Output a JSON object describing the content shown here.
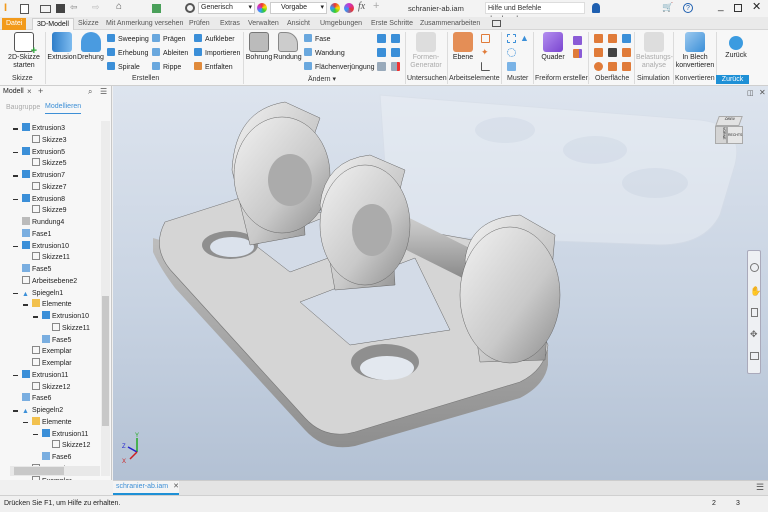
{
  "titlebar": {
    "appearance_style": "Generisch",
    "material": "Vorgabe",
    "document_title": "schranier-ab.iam",
    "search_placeholder": "Hilfe und Befehle durchsuchen...",
    "help_label": "?"
  },
  "tabs": [
    "Datei",
    "3D-Modell",
    "Skizze",
    "Mit Anmerkung versehen",
    "Prüfen",
    "Extras",
    "Verwalten",
    "Ansicht",
    "Umgebungen",
    "Erste Schritte",
    "Zusammenarbeiten"
  ],
  "active_tab": "3D-Modell",
  "ribbon": {
    "skizze": {
      "button": "2D-Skizze starten",
      "label": "Skizze"
    },
    "erstellen": {
      "label": "Erstellen",
      "extrusion": "Extrusion",
      "drehung": "Drehung",
      "col1": [
        "Sweeping",
        "Erhebung",
        "Spirale"
      ],
      "col2": [
        "Prägen",
        "Ableiten",
        "Rippe"
      ],
      "col3": [
        "Aufkleber",
        "Importieren",
        "Entfalten"
      ]
    },
    "aendern": {
      "label": "Ändern ▾",
      "bohrung": "Bohrung",
      "rundung": "Rundung",
      "col": [
        "Fase",
        "Wandung",
        "Flächenverjüngung"
      ]
    },
    "untersuchen": {
      "label": "Untersuchen",
      "button": "Formen-Generator"
    },
    "arbeitselemente": {
      "label": "Arbeitselemente",
      "button": "Ebene"
    },
    "muster": {
      "label": "Muster"
    },
    "freiform": {
      "label": "Freiform erstellen",
      "button": "Quader"
    },
    "oberflaeche": {
      "label": "Oberfläche"
    },
    "simulation": {
      "label": "Simulation",
      "button": "Belastungs-analyse"
    },
    "konvertieren": {
      "label": "Konvertieren",
      "button": "In Blech konvertieren"
    },
    "zurueck": {
      "label": "Zurück",
      "button": "Zurück"
    }
  },
  "browser": {
    "title": "Modell",
    "subtab_assembly": "Baugruppe",
    "subtab_modeling": "Modellieren",
    "tree": [
      {
        "label": "Extrusion3",
        "level": 0,
        "icon": "extrusion",
        "expanded": true
      },
      {
        "label": "Skizze3",
        "level": 1,
        "icon": "sketch"
      },
      {
        "label": "Extrusion5",
        "level": 0,
        "icon": "extrusion",
        "expanded": true
      },
      {
        "label": "Skizze5",
        "level": 1,
        "icon": "sketch"
      },
      {
        "label": "Extrusion7",
        "level": 0,
        "icon": "extrusion",
        "expanded": true
      },
      {
        "label": "Skizze7",
        "level": 1,
        "icon": "sketch"
      },
      {
        "label": "Extrusion8",
        "level": 0,
        "icon": "extrusion",
        "expanded": true
      },
      {
        "label": "Skizze9",
        "level": 1,
        "icon": "sketch"
      },
      {
        "label": "Rundung4",
        "level": 0,
        "icon": "fillet"
      },
      {
        "label": "Fase1",
        "level": 0,
        "icon": "chamfer"
      },
      {
        "label": "Extrusion10",
        "level": 0,
        "icon": "extrusion",
        "expanded": true
      },
      {
        "label": "Skizze11",
        "level": 1,
        "icon": "sketch"
      },
      {
        "label": "Fase5",
        "level": 0,
        "icon": "chamfer"
      },
      {
        "label": "Arbeitsebene2",
        "level": 0,
        "icon": "workplane"
      },
      {
        "label": "Spiegeln1",
        "level": 0,
        "icon": "mirror",
        "expanded": true
      },
      {
        "label": "Elemente",
        "level": 1,
        "icon": "folder",
        "expanded": true
      },
      {
        "label": "Extrusion10",
        "level": 2,
        "icon": "extrusion",
        "expanded": true
      },
      {
        "label": "Skizze11",
        "level": 3,
        "icon": "sketch"
      },
      {
        "label": "Fase5",
        "level": 2,
        "icon": "chamfer"
      },
      {
        "label": "Exemplar",
        "level": 1,
        "icon": "instance"
      },
      {
        "label": "Exemplar",
        "level": 1,
        "icon": "instance"
      },
      {
        "label": "Extrusion11",
        "level": 0,
        "icon": "extrusion",
        "expanded": true
      },
      {
        "label": "Skizze12",
        "level": 1,
        "icon": "sketch"
      },
      {
        "label": "Fase6",
        "level": 0,
        "icon": "chamfer"
      },
      {
        "label": "Spiegeln2",
        "level": 0,
        "icon": "mirror",
        "expanded": true
      },
      {
        "label": "Elemente",
        "level": 1,
        "icon": "folder",
        "expanded": true
      },
      {
        "label": "Extrusion11",
        "level": 2,
        "icon": "extrusion",
        "expanded": true
      },
      {
        "label": "Skizze12",
        "level": 3,
        "icon": "sketch"
      },
      {
        "label": "Fase6",
        "level": 2,
        "icon": "chamfer"
      },
      {
        "label": "Exemplar",
        "level": 1,
        "icon": "instance"
      },
      {
        "label": "Exemplar",
        "level": 1,
        "icon": "instance"
      }
    ]
  },
  "viewcube": {
    "face_front": "VORNE",
    "face_right": "RECHTS",
    "face_top": "OBEN"
  },
  "axes": {
    "x": "X",
    "y": "Y",
    "z": "Z"
  },
  "document_tab": "schranier-ab.iam",
  "status": {
    "message": "Drücken Sie F1, um Hilfe zu erhalten.",
    "count1": "2",
    "count2": "3"
  },
  "colors": {
    "accent": "#1e90d6",
    "file_tab": "#f29a1b",
    "extrusion_icon": "#3b8fd8",
    "surface_icon": "#e07b39",
    "freeform": "#8a5bd6"
  }
}
